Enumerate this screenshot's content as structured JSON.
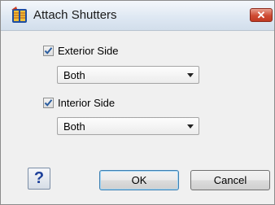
{
  "window": {
    "title": "Attach Shutters",
    "close_glyph": "✕"
  },
  "exterior": {
    "label": "Exterior Side",
    "checked": true,
    "selected": "Both"
  },
  "interior": {
    "label": "Interior Side",
    "checked": true,
    "selected": "Both"
  },
  "buttons": {
    "help": "?",
    "ok": "OK",
    "cancel": "Cancel"
  },
  "icons": {
    "app": "shutters-app-icon",
    "close": "close-icon",
    "check": "checkmark-icon",
    "dropdown": "chevron-down-icon"
  },
  "colors": {
    "accent": "#3c7fb1",
    "close": "#cf4b33",
    "help": "#1b3f9a",
    "check": "#2a5d9f"
  }
}
